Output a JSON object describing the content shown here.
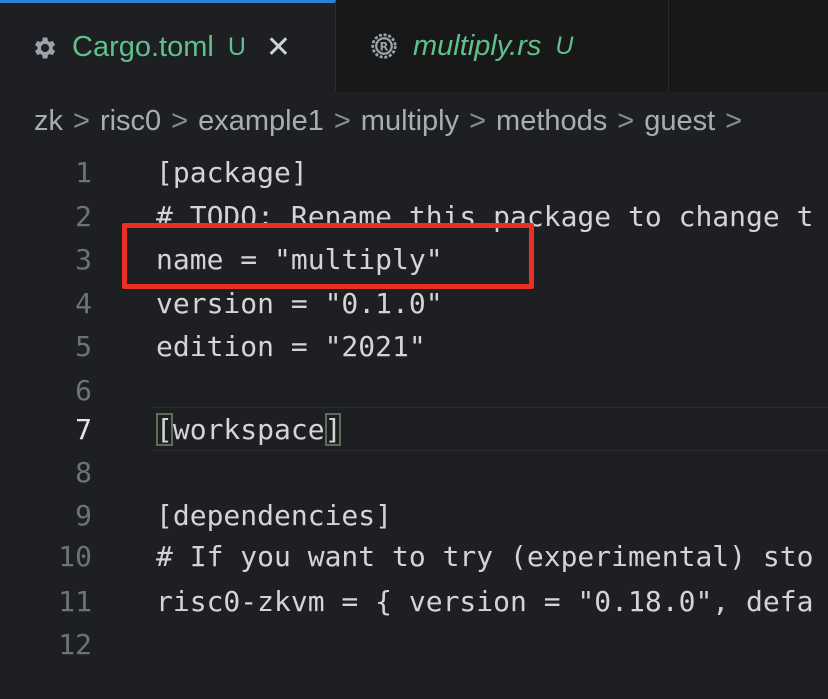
{
  "tabs": [
    {
      "label": "Cargo.toml",
      "badge": "U",
      "icon": "gear-icon",
      "active": true,
      "color": "#5fc08b"
    },
    {
      "label": "multiply.rs",
      "badge": "U",
      "icon": "rust-icon",
      "active": false,
      "color": "#5fc08b"
    }
  ],
  "breadcrumb": [
    "zk",
    "risc0",
    "example1",
    "multiply",
    "methods",
    "guest"
  ],
  "breadcrumb_separator": ">",
  "editor": {
    "current_line": 7,
    "lines": [
      {
        "num": "1",
        "text": "[package]"
      },
      {
        "num": "2",
        "text": "# TODO: Rename this package to change t"
      },
      {
        "num": "3",
        "text": "name = \"multiply\""
      },
      {
        "num": "4",
        "text": "version = \"0.1.0\""
      },
      {
        "num": "5",
        "text": "edition = \"2021\""
      },
      {
        "num": "6",
        "text": ""
      },
      {
        "num": "7",
        "text_open": "[",
        "text_mid": "workspace",
        "text_close": "]"
      },
      {
        "num": "8",
        "text": ""
      },
      {
        "num": "9",
        "text": "[dependencies]"
      },
      {
        "num": "10",
        "text": "# If you want to try (experimental) sto"
      },
      {
        "num": "11",
        "text": "risc0-zkvm = { version = \"0.18.0\", defa"
      },
      {
        "num": "12",
        "text": ""
      }
    ]
  },
  "colors": {
    "accent": "#2f7fd6",
    "untracked_green": "#5fc08b",
    "highlight_red": "#ec2f24"
  }
}
